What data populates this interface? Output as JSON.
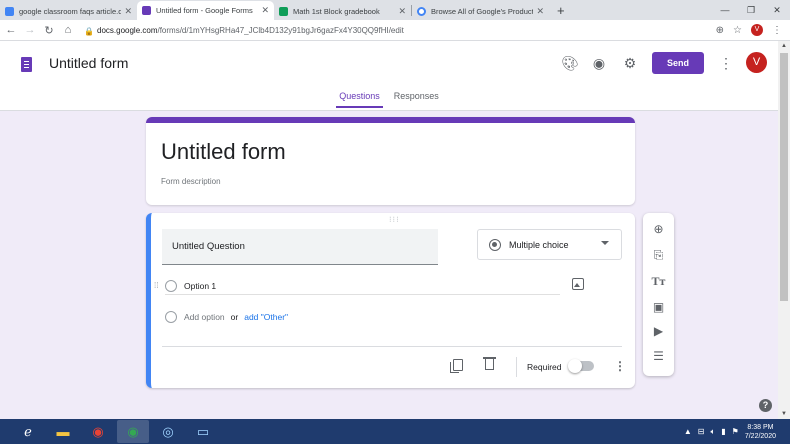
{
  "browser": {
    "tabs": [
      {
        "label": "google classroom faqs article.do",
        "color": "#4285f4",
        "active": false
      },
      {
        "label": "Untitled form - Google Forms",
        "color": "#673ab7",
        "active": true
      },
      {
        "label": "Math 1st Block gradebook",
        "color": "#0f9d58",
        "active": false
      },
      {
        "label": "Browse All of Google's Products",
        "color": "#4285f4",
        "active": false
      }
    ],
    "url_host": "docs.google.com",
    "url_path": "/forms/d/1mYHsgRHa47_JClb4D132y91bgJr6gazFx4Y30QQ9fHI/edit",
    "profile_initial": "V"
  },
  "header": {
    "title": "Untitled form",
    "send_label": "Send",
    "avatar_initial": "V",
    "tabs": [
      "Questions",
      "Responses"
    ]
  },
  "title_card": {
    "title": "Untitled form",
    "description_placeholder": "Form description"
  },
  "question": {
    "title": "Untitled Question",
    "type": "Multiple choice",
    "option_1": "Option 1",
    "add_option": "Add option",
    "or_text": "or",
    "add_other": "add \"Other\"",
    "required_label": "Required"
  },
  "taskbar": {
    "time": "8:38 PM",
    "date": "7/22/2020"
  },
  "colors": {
    "brand": "#673ab7",
    "accent_blue": "#4285f4",
    "background": "#f0ebf8"
  }
}
